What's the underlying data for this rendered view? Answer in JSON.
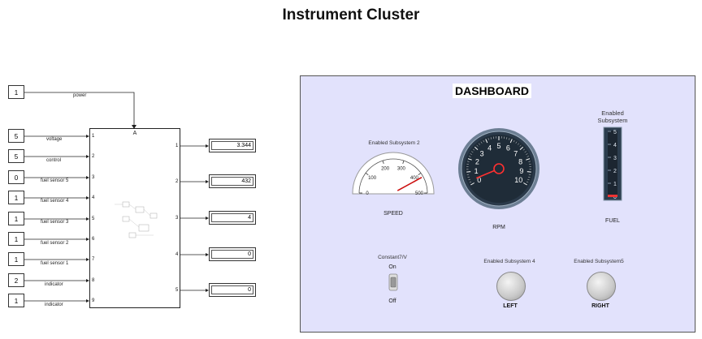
{
  "title": "Instrument Cluster",
  "constants": [
    {
      "value": "1",
      "label": "power"
    },
    {
      "value": "5",
      "label": "voltage"
    },
    {
      "value": "5",
      "label": "control"
    },
    {
      "value": "0",
      "label": "fuel sensor 5"
    },
    {
      "value": "1",
      "label": "fuel sensor 4"
    },
    {
      "value": "1",
      "label": "fuel sensor 3"
    },
    {
      "value": "1",
      "label": "fuel sensor 2"
    },
    {
      "value": "1",
      "label": "fuel sensor 1"
    },
    {
      "value": "2",
      "label": "indicator"
    },
    {
      "value": "1",
      "label": "indicator"
    }
  ],
  "subsystem": {
    "inports": [
      "1",
      "2",
      "3",
      "4",
      "5",
      "6",
      "7",
      "8",
      "9"
    ],
    "outports": [
      "1",
      "2",
      "3",
      "4",
      "5"
    ]
  },
  "displays": [
    "3.344",
    "432",
    "4",
    "0",
    "0"
  ],
  "dashboard": {
    "title": "DASHBOARD",
    "speed": {
      "caption": "Enabled Subsystem 2",
      "label": "SPEED",
      "ticks": [
        "0",
        "100",
        "200",
        "300",
        "400",
        "500"
      ],
      "value": 420
    },
    "rpm": {
      "label": "RPM",
      "ticks": [
        "0",
        "1",
        "2",
        "3",
        "4",
        "5",
        "6",
        "7",
        "8",
        "9",
        "10"
      ],
      "value": 0.3
    },
    "fuel": {
      "caption": "Enabled Subsystem",
      "label": "FUEL",
      "ticks": [
        "5",
        "4",
        "3",
        "2",
        "1",
        "0"
      ],
      "value": 0.1
    },
    "switch": {
      "caption": "Constant7/V",
      "on": "On",
      "off": "Off"
    },
    "left": {
      "caption": "Enabled Subsystem 4",
      "label": "LEFT"
    },
    "right": {
      "caption": "Enabled Subsystem5",
      "label": "RIGHT"
    }
  }
}
